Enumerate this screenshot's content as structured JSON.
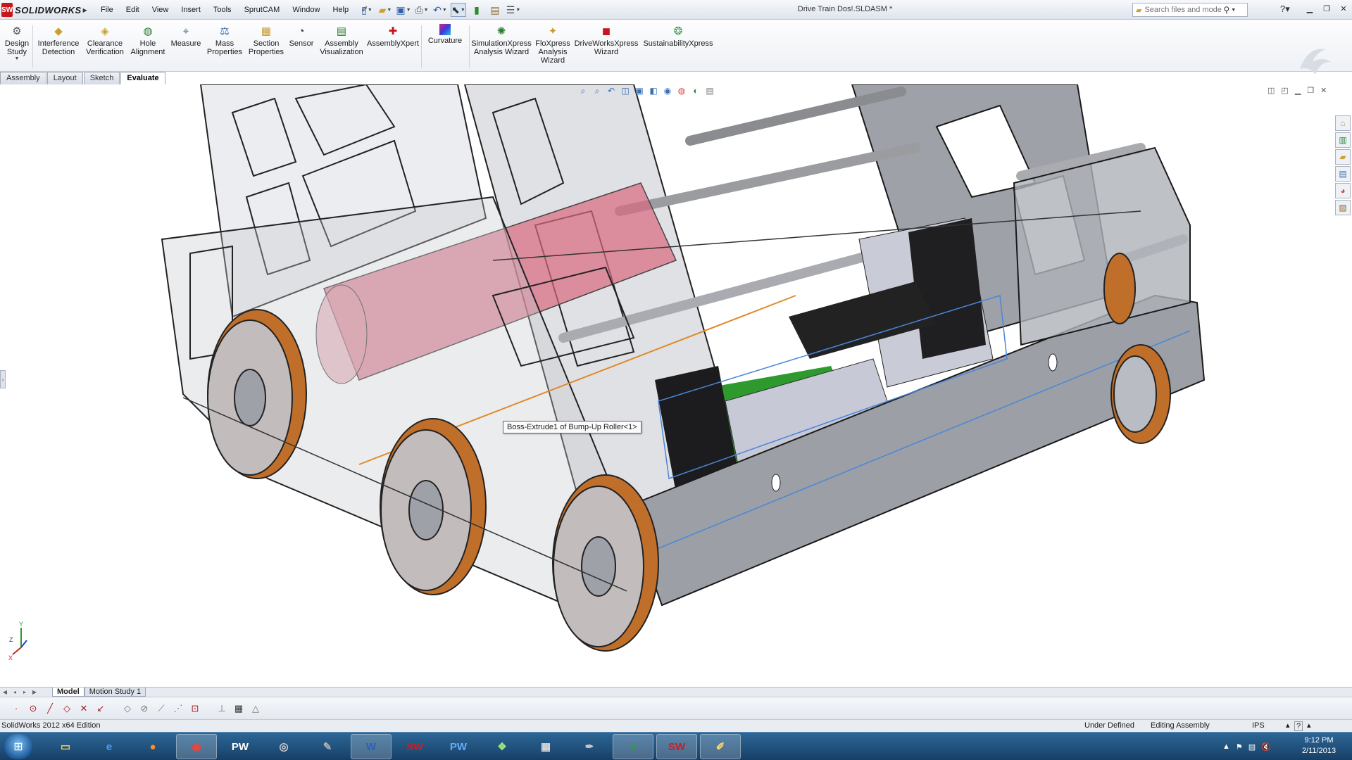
{
  "app": {
    "product_name": "SOLIDWORKS",
    "document_title": "Drive Train Dos!.SLDASM *",
    "edition": "SolidWorks 2012 x64 Edition"
  },
  "menu": [
    "File",
    "Edit",
    "View",
    "Insert",
    "Tools",
    "SprutCAM",
    "Window",
    "Help"
  ],
  "search": {
    "placeholder": "Search files and models"
  },
  "commands": [
    {
      "label": "Design\nStudy",
      "icon": "design-study-icon"
    },
    {
      "label": "Interference\nDetection",
      "icon": "interference-detection-icon"
    },
    {
      "label": "Clearance\nVerification",
      "icon": "clearance-verification-icon"
    },
    {
      "label": "Hole\nAlignment",
      "icon": "hole-alignment-icon"
    },
    {
      "label": "Measure",
      "icon": "measure-icon"
    },
    {
      "label": "Mass\nProperties",
      "icon": "mass-properties-icon"
    },
    {
      "label": "Section\nProperties",
      "icon": "section-properties-icon"
    },
    {
      "label": "Sensor",
      "icon": "sensor-icon"
    },
    {
      "label": "Assembly\nVisualization",
      "icon": "assembly-visualization-icon"
    },
    {
      "label": "AssemblyXpert",
      "icon": "assemblyxpert-icon"
    },
    {
      "label": "Curvature",
      "icon": "curvature-icon"
    },
    {
      "label": "SimulationXpress\nAnalysis Wizard",
      "icon": "simulationxpress-icon"
    },
    {
      "label": "FloXpress\nAnalysis\nWizard",
      "icon": "floxpress-icon"
    },
    {
      "label": "DriveWorksXpress\nWizard",
      "icon": "driveworksxpress-icon"
    },
    {
      "label": "SustainabilityXpress",
      "icon": "sustainabilityxpress-icon"
    }
  ],
  "tabs": [
    {
      "label": "Assembly"
    },
    {
      "label": "Layout"
    },
    {
      "label": "Sketch"
    },
    {
      "label": "Evaluate",
      "active": true
    }
  ],
  "graphics": {
    "tooltip": "Boss-Extrude1 of Bump-Up Roller<1>",
    "triad": {
      "x": "X",
      "y": "Y",
      "z": "Z"
    }
  },
  "bottom_tabs": [
    {
      "label": "Model",
      "active": true
    },
    {
      "label": "Motion Study 1"
    }
  ],
  "status": {
    "under_defined": "Under Defined",
    "editing": "Editing Assembly",
    "units": "IPS",
    "help": "?"
  },
  "clock": {
    "time": "9:12 PM",
    "date": "2/11/2013"
  },
  "taskbar_apps": [
    {
      "icon": "file-explorer-icon",
      "glyph": "▭"
    },
    {
      "icon": "internet-explorer-icon",
      "glyph": "e"
    },
    {
      "icon": "firefox-icon",
      "glyph": "●"
    },
    {
      "icon": "chrome-icon",
      "glyph": "◉",
      "active": true
    },
    {
      "icon": "pw-icon",
      "glyph": "PW"
    },
    {
      "icon": "camera-icon",
      "glyph": "◎"
    },
    {
      "icon": "gimp-icon",
      "glyph": "✎"
    },
    {
      "icon": "word-icon",
      "glyph": "W",
      "active": true
    },
    {
      "icon": "solidworks-icon",
      "glyph": "SW"
    },
    {
      "icon": "pw3d-icon",
      "glyph": "PW"
    },
    {
      "icon": "green-app-icon",
      "glyph": "❖"
    },
    {
      "icon": "calculator-icon",
      "glyph": "▦"
    },
    {
      "icon": "pen-tool-icon",
      "glyph": "✒"
    },
    {
      "icon": "excel-icon",
      "glyph": "X",
      "active": true
    },
    {
      "icon": "solidworks-active-icon",
      "glyph": "SW",
      "active": true
    },
    {
      "icon": "paint-icon",
      "glyph": "✐",
      "active": true
    }
  ]
}
